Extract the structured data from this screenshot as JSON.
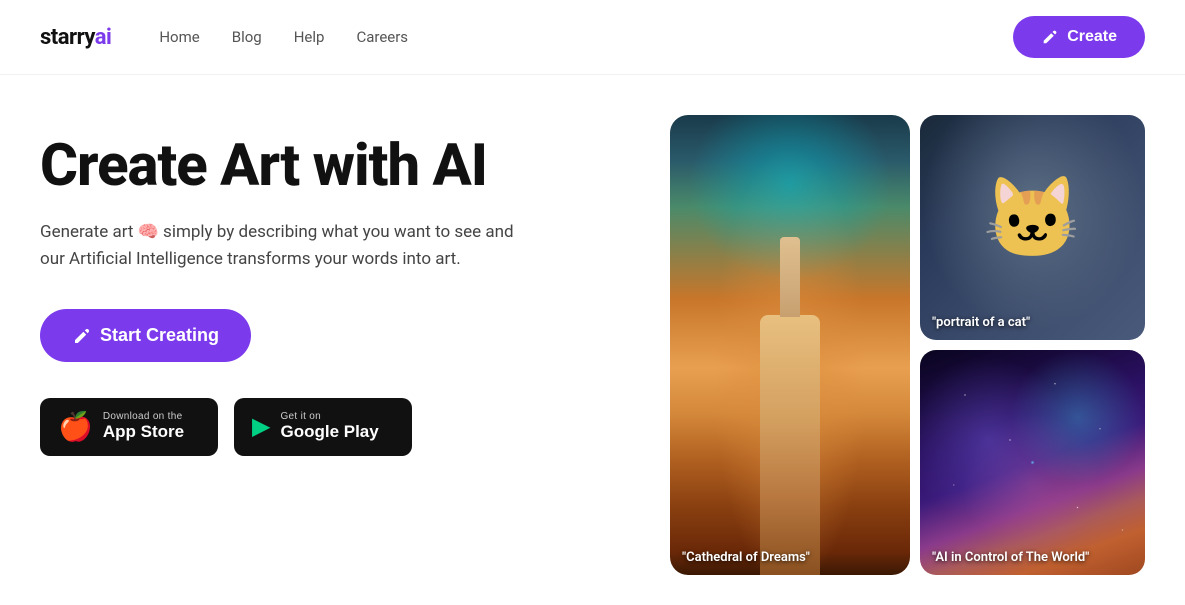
{
  "logo": {
    "text_starry": "starry",
    "text_ai": "ai"
  },
  "nav": {
    "items": [
      {
        "label": "Home",
        "href": "#"
      },
      {
        "label": "Blog",
        "href": "#"
      },
      {
        "label": "Help",
        "href": "#"
      },
      {
        "label": "Careers",
        "href": "#"
      }
    ]
  },
  "header": {
    "create_label": "Create"
  },
  "hero": {
    "title": "Create Art with AI",
    "subtitle": "Generate art 🧠 simply by describing what you want to see and our Artificial Intelligence transforms your words into art.",
    "cta_label": "Start Creating"
  },
  "store": {
    "appstore": {
      "line1": "Download on the",
      "line2": "App Store"
    },
    "googleplay": {
      "line1": "Get it on",
      "line2": "Google Play"
    }
  },
  "art_cards": [
    {
      "id": "cathedral",
      "label": "\"Cathedral of Dreams\"",
      "type": "tall"
    },
    {
      "id": "cat",
      "label": "\"portrait of a cat\"",
      "type": "normal"
    },
    {
      "id": "space",
      "label": "\"AI in Control of The World\"",
      "type": "normal"
    }
  ],
  "colors": {
    "accent": "#7c3aed",
    "dark": "#111111",
    "text_secondary": "#444444"
  }
}
